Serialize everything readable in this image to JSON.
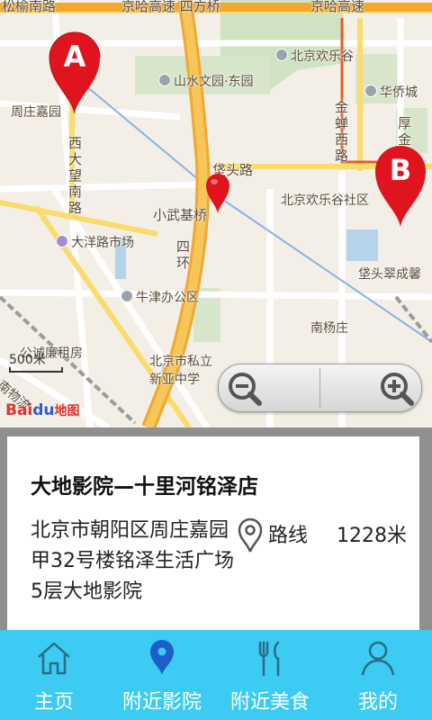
{
  "map": {
    "labels": {
      "top_road_left": "松榆南路",
      "top_road_mid": "京哈高速 四方桥",
      "top_road_right": "京哈高速",
      "shanshuiwenyuan": "山水文园·东园",
      "huanlegu": "北京欢乐谷",
      "zhouzhuangjiayuan": "周庄嘉园",
      "huaqiaocheng": "华侨城",
      "xidawang_road": "西大望南路",
      "jinzhanxi_road": "金蝉西路",
      "hou_road": "厚金",
      "jiatou_road": "垡头路",
      "xiaowuji": "小武基桥",
      "huanlegu_community": "北京欢乐谷社区",
      "dayanglu_market": "大洋路市场",
      "sihuan": "四环",
      "jiatoucuichengxi": "垡头翠成馨",
      "niujin_office": "牛津办公区",
      "nanyangzhuang": "南杨庄",
      "rental": "公诚廉租房",
      "school": "北京市私立新亚中学",
      "logistics": "南物流"
    },
    "scale_text": "500米",
    "logo": {
      "part1": "Bai",
      "part2": "du",
      "part3": "地图"
    },
    "markers": {
      "a": "A",
      "b": "B"
    },
    "zoom_out_icon": "zoom-out-icon",
    "zoom_in_icon": "zoom-in-icon"
  },
  "cinema": {
    "name": "大地影院—十里河铭泽店",
    "address": "北京市朝阳区周庄嘉园甲32号楼铭泽生活广场5层大地影院",
    "route_icon": "location-pin-icon",
    "route_label": "路线",
    "distance": "1228米"
  },
  "nav": {
    "items": [
      {
        "label": "主页",
        "icon": "home-icon"
      },
      {
        "label": "附近影院",
        "icon": "location-icon"
      },
      {
        "label": "附近美食",
        "icon": "fork-knife-icon"
      },
      {
        "label": "我的",
        "icon": "user-icon"
      }
    ]
  },
  "colors": {
    "nav_bg": "#3ccbf2",
    "marker_red": "#e0141e",
    "main_road": "#f5b63b",
    "map_bg": "#f3efe6"
  }
}
